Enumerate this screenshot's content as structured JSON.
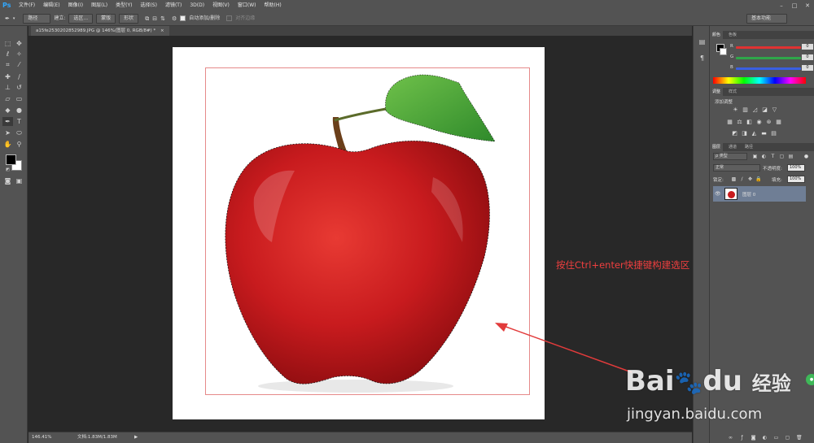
{
  "app": {
    "logo": "Ps",
    "menus": [
      "文件(F)",
      "编辑(E)",
      "图像(I)",
      "图层(L)",
      "类型(Y)",
      "选择(S)",
      "滤镜(T)",
      "3D(D)",
      "视图(V)",
      "窗口(W)",
      "帮助(H)"
    ],
    "window_controls": [
      "–",
      "□",
      "✕"
    ]
  },
  "options_bar": {
    "mode_select": "路径",
    "make_label": "建立:",
    "selection_button": "选区...",
    "mask_button": "蒙版",
    "shape_button": "形状",
    "auto_add_delete": "自动添加/删除",
    "align_edges": "对齐边缘",
    "workspace": "基本功能"
  },
  "document": {
    "tab_title": "a15fe2530202852989.JPG @ 146%(图层 0, RGB/8#) *",
    "tab_close": "×",
    "zoom": "146.41%",
    "doc_size": "文档:1.83M/1.83M"
  },
  "annotation": {
    "text": "按住Ctrl+enter快捷键构建选区",
    "color": "#ef3f3f"
  },
  "watermark": {
    "brand_a": "Bai",
    "brand_b": "du",
    "brand_cn": "经验",
    "url": "jingyan.baidu.com"
  },
  "panels": {
    "color": {
      "tabs": [
        "颜色",
        "色板"
      ],
      "channels": [
        {
          "label": "R",
          "value": "0",
          "color": "#e03232"
        },
        {
          "label": "G",
          "value": "0",
          "color": "#2fa64a"
        },
        {
          "label": "B",
          "value": "0",
          "color": "#3a5fe0"
        }
      ]
    },
    "adjustments": {
      "tabs": [
        "调整",
        "样式"
      ],
      "title": "添加调整"
    },
    "layers": {
      "tabs": [
        "图层",
        "通道",
        "路径"
      ],
      "kind_filter": "ρ 类型",
      "blend_mode": "正常",
      "opacity_label": "不透明度:",
      "opacity_value": "100%",
      "lock_label": "锁定:",
      "fill_label": "填充:",
      "fill_value": "100%",
      "layer_name": "图层 0",
      "layer_row_color": "#6f7e95"
    }
  },
  "colors": {
    "ui_bg": "#535353",
    "pasteboard": "#282828",
    "ps_blue": "#31a8ff"
  }
}
